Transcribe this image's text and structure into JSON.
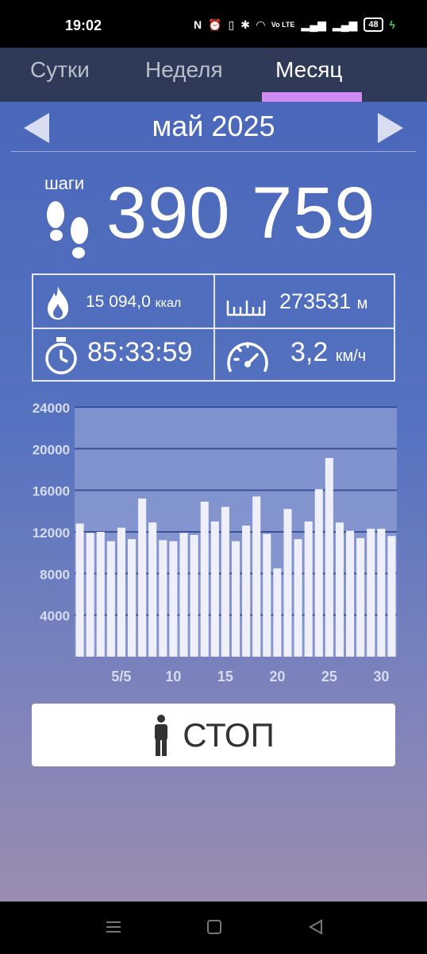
{
  "status_bar": {
    "time": "19:02",
    "battery": "48",
    "network": "Vo LTE"
  },
  "tabs": [
    {
      "label": "Сутки",
      "active": false
    },
    {
      "label": "Неделя",
      "active": false
    },
    {
      "label": "Месяц",
      "active": true
    }
  ],
  "header": {
    "month": "май 2025"
  },
  "steps": {
    "label": "шаги",
    "value": "390 759"
  },
  "stats": {
    "calories": {
      "value": "15 094,0",
      "unit": "ккал"
    },
    "distance": {
      "value": "273531",
      "unit": "м"
    },
    "duration": {
      "value": "85:33:59"
    },
    "speed": {
      "value": "3,2",
      "unit": "км/ч"
    }
  },
  "chart_data": {
    "type": "bar",
    "title": "",
    "x": [
      1,
      2,
      3,
      4,
      5,
      6,
      7,
      8,
      9,
      10,
      11,
      12,
      13,
      14,
      15,
      16,
      17,
      18,
      19,
      20,
      21,
      22,
      23,
      24,
      25,
      26,
      27,
      28,
      29,
      30,
      31
    ],
    "x_tick_labels": [
      "5/5",
      "10",
      "15",
      "20",
      "25",
      "30"
    ],
    "x_tick_values": [
      5,
      10,
      15,
      20,
      25,
      30
    ],
    "y_ticks": [
      "4000",
      "8000",
      "12000",
      "16000",
      "20000",
      "24000"
    ],
    "ylim": [
      0,
      24000
    ],
    "values": [
      12800,
      11900,
      12000,
      11100,
      12400,
      11300,
      15200,
      12900,
      11200,
      11100,
      11900,
      11700,
      14900,
      13000,
      14400,
      11100,
      12600,
      15400,
      11800,
      8500,
      14200,
      11300,
      13000,
      16100,
      19100,
      12900,
      12100,
      11400,
      12300,
      12300,
      11600
    ],
    "grid": true,
    "colors": {
      "bar": "#eeeff8",
      "plot_bg": "#8d9dd3",
      "grid": "#3a519a"
    }
  },
  "stop_button": {
    "label": "СТОП"
  }
}
